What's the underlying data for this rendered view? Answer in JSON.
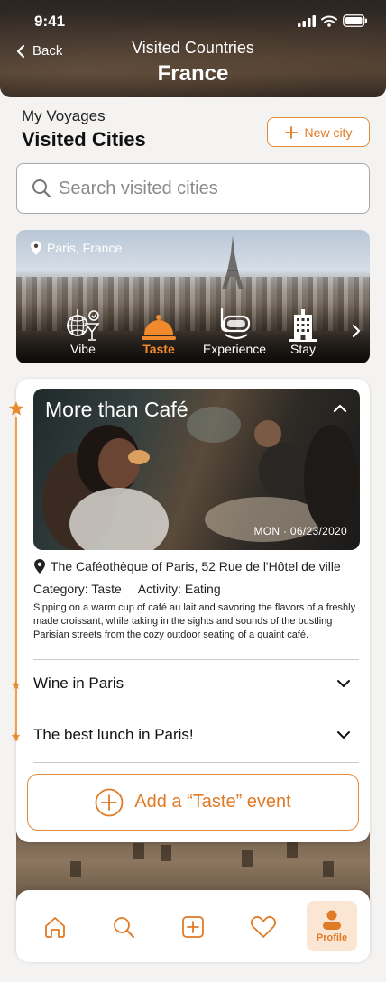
{
  "status": {
    "time": "9:41"
  },
  "header": {
    "back_label": "Back",
    "subtitle": "Visited Countries",
    "title": "France"
  },
  "voyages": {
    "label": "My Voyages",
    "title": "Visited Cities",
    "new_city_label": "New city"
  },
  "search": {
    "placeholder": "Search visited cities"
  },
  "city_card": {
    "location": "Paris, France",
    "tabs": [
      {
        "label": "Vibe",
        "icon": "disco-cocktail-icon",
        "active": false
      },
      {
        "label": "Taste",
        "icon": "cloche-icon",
        "active": true
      },
      {
        "label": "Experience",
        "icon": "snorkel-mask-icon",
        "active": false
      },
      {
        "label": "Stay",
        "icon": "hotel-icon",
        "active": false
      }
    ]
  },
  "event": {
    "title": "More than Café",
    "date": "MON · 06/23/2020",
    "location": "The Caféothèque of Paris, 52 Rue de l'Hôtel de ville",
    "category": "Category: Taste",
    "activity": "Activity: Eating",
    "description": "Sipping on a warm cup of café au lait and savoring the flavors of a freshly made croissant, while taking in the sights and sounds of the bustling Parisian streets from the cozy outdoor seating of a quaint café."
  },
  "other_events": [
    {
      "title": "Wine in Paris"
    },
    {
      "title": "The best lunch in Paris!"
    }
  ],
  "add_event_label": "Add a “Taste” event",
  "bottom_nav": {
    "items": [
      {
        "name": "home",
        "icon": "home-icon"
      },
      {
        "name": "search",
        "icon": "search-icon"
      },
      {
        "name": "add",
        "icon": "plus-square-icon"
      },
      {
        "name": "favorites",
        "icon": "heart-icon"
      },
      {
        "name": "profile",
        "icon": "profile-icon",
        "label": "Profile",
        "active": true
      }
    ]
  },
  "colors": {
    "accent": "#E07A25",
    "accent_light": "#FBE6D3",
    "text": "#222222"
  }
}
